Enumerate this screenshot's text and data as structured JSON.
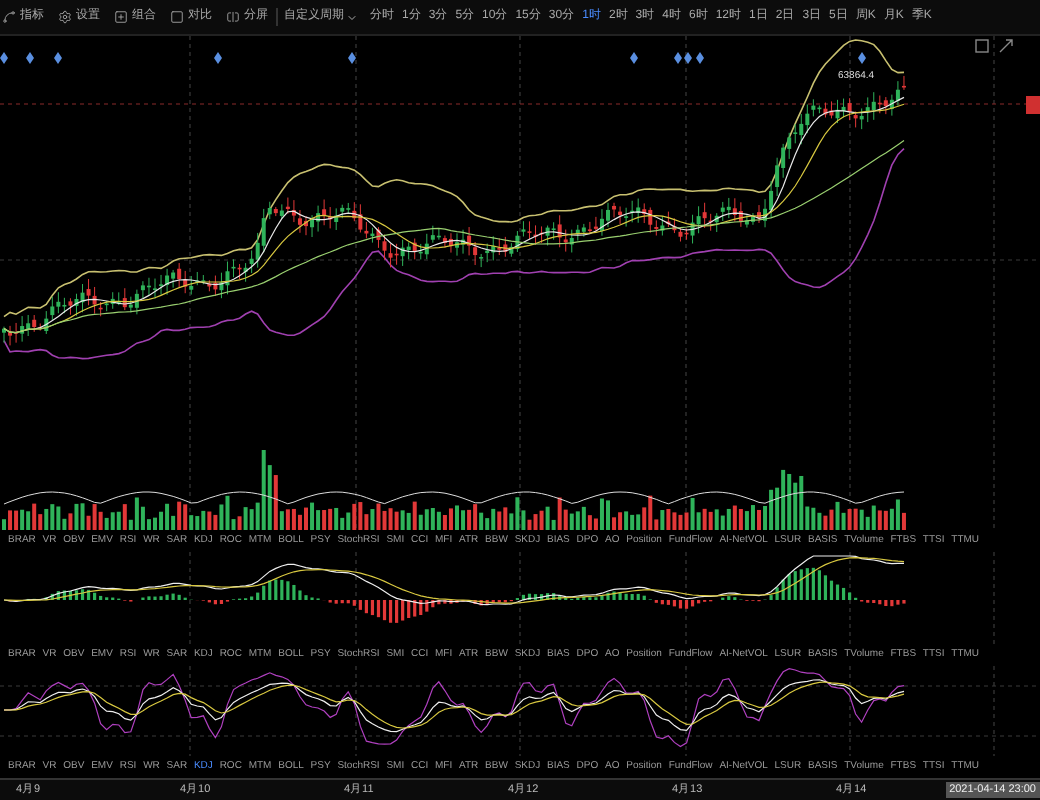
{
  "toolbar": {
    "tools": [
      {
        "kind": "draw",
        "label": "指标"
      },
      {
        "kind": "settings",
        "label": "设置"
      },
      {
        "kind": "combo",
        "label": "组合"
      },
      {
        "kind": "compare",
        "label": "对比"
      },
      {
        "kind": "split",
        "label": "分屏"
      }
    ],
    "custom_period": "自定义周期",
    "periods": [
      {
        "label": "分时",
        "selected": false
      },
      {
        "label": "1分",
        "selected": false
      },
      {
        "label": "3分",
        "selected": false
      },
      {
        "label": "5分",
        "selected": false
      },
      {
        "label": "10分",
        "selected": false
      },
      {
        "label": "15分",
        "selected": false
      },
      {
        "label": "30分",
        "selected": false
      },
      {
        "label": "1时",
        "selected": true
      },
      {
        "label": "2时",
        "selected": false
      },
      {
        "label": "3时",
        "selected": false
      },
      {
        "label": "4时",
        "selected": false
      },
      {
        "label": "6时",
        "selected": false
      },
      {
        "label": "12时",
        "selected": false
      },
      {
        "label": "1日",
        "selected": false
      },
      {
        "label": "2日",
        "selected": false
      },
      {
        "label": "3日",
        "selected": false
      },
      {
        "label": "5日",
        "selected": false
      },
      {
        "label": "周K",
        "selected": false
      },
      {
        "label": "月K",
        "selected": false
      },
      {
        "label": "季K",
        "selected": false
      }
    ]
  },
  "main_chart": {
    "price_label": "63864.4"
  },
  "indicator_rows": [
    {
      "tabs": [
        {
          "label": "BRAR",
          "selected": false
        },
        {
          "label": "VR",
          "selected": false
        },
        {
          "label": "OBV",
          "selected": false
        },
        {
          "label": "EMV",
          "selected": false
        },
        {
          "label": "RSI",
          "selected": false
        },
        {
          "label": "WR",
          "selected": false
        },
        {
          "label": "SAR",
          "selected": false
        },
        {
          "label": "KDJ",
          "selected": false
        },
        {
          "label": "ROC",
          "selected": false
        },
        {
          "label": "MTM",
          "selected": false
        },
        {
          "label": "BOLL",
          "selected": false
        },
        {
          "label": "PSY",
          "selected": false
        },
        {
          "label": "StochRSI",
          "selected": false
        },
        {
          "label": "SMI",
          "selected": false
        },
        {
          "label": "CCI",
          "selected": false
        },
        {
          "label": "MFI",
          "selected": false
        },
        {
          "label": "ATR",
          "selected": false
        },
        {
          "label": "BBW",
          "selected": false
        },
        {
          "label": "SKDJ",
          "selected": false
        },
        {
          "label": "BIAS",
          "selected": false
        },
        {
          "label": "DPO",
          "selected": false
        },
        {
          "label": "AO",
          "selected": false
        },
        {
          "label": "Position",
          "selected": false
        },
        {
          "label": "FundFlow",
          "selected": false
        },
        {
          "label": "AI-NetVOL",
          "selected": false
        },
        {
          "label": "LSUR",
          "selected": false
        },
        {
          "label": "BASIS",
          "selected": false
        },
        {
          "label": "TVolume",
          "selected": false
        },
        {
          "label": "FTBS",
          "selected": false
        },
        {
          "label": "TTSI",
          "selected": false
        },
        {
          "label": "TTMU",
          "selected": false
        }
      ]
    },
    {
      "tabs": [
        {
          "label": "BRAR",
          "selected": false
        },
        {
          "label": "VR",
          "selected": false
        },
        {
          "label": "OBV",
          "selected": false
        },
        {
          "label": "EMV",
          "selected": false
        },
        {
          "label": "RSI",
          "selected": false
        },
        {
          "label": "WR",
          "selected": false
        },
        {
          "label": "SAR",
          "selected": false
        },
        {
          "label": "KDJ",
          "selected": false
        },
        {
          "label": "ROC",
          "selected": false
        },
        {
          "label": "MTM",
          "selected": false
        },
        {
          "label": "BOLL",
          "selected": false
        },
        {
          "label": "PSY",
          "selected": false
        },
        {
          "label": "StochRSI",
          "selected": false
        },
        {
          "label": "SMI",
          "selected": false
        },
        {
          "label": "CCI",
          "selected": false
        },
        {
          "label": "MFI",
          "selected": false
        },
        {
          "label": "ATR",
          "selected": false
        },
        {
          "label": "BBW",
          "selected": false
        },
        {
          "label": "SKDJ",
          "selected": false
        },
        {
          "label": "BIAS",
          "selected": false
        },
        {
          "label": "DPO",
          "selected": false
        },
        {
          "label": "AO",
          "selected": false
        },
        {
          "label": "Position",
          "selected": false
        },
        {
          "label": "FundFlow",
          "selected": false
        },
        {
          "label": "AI-NetVOL",
          "selected": false
        },
        {
          "label": "LSUR",
          "selected": false
        },
        {
          "label": "BASIS",
          "selected": false
        },
        {
          "label": "TVolume",
          "selected": false
        },
        {
          "label": "FTBS",
          "selected": false
        },
        {
          "label": "TTSI",
          "selected": false
        },
        {
          "label": "TTMU",
          "selected": false
        }
      ]
    },
    {
      "tabs": [
        {
          "label": "BRAR",
          "selected": false
        },
        {
          "label": "VR",
          "selected": false
        },
        {
          "label": "OBV",
          "selected": false
        },
        {
          "label": "EMV",
          "selected": false
        },
        {
          "label": "RSI",
          "selected": false
        },
        {
          "label": "WR",
          "selected": false
        },
        {
          "label": "SAR",
          "selected": false
        },
        {
          "label": "KDJ",
          "selected": true
        },
        {
          "label": "ROC",
          "selected": false
        },
        {
          "label": "MTM",
          "selected": false
        },
        {
          "label": "BOLL",
          "selected": false
        },
        {
          "label": "PSY",
          "selected": false
        },
        {
          "label": "StochRSI",
          "selected": false
        },
        {
          "label": "SMI",
          "selected": false
        },
        {
          "label": "CCI",
          "selected": false
        },
        {
          "label": "MFI",
          "selected": false
        },
        {
          "label": "ATR",
          "selected": false
        },
        {
          "label": "BBW",
          "selected": false
        },
        {
          "label": "SKDJ",
          "selected": false
        },
        {
          "label": "BIAS",
          "selected": false
        },
        {
          "label": "DPO",
          "selected": false
        },
        {
          "label": "AO",
          "selected": false
        },
        {
          "label": "Position",
          "selected": false
        },
        {
          "label": "FundFlow",
          "selected": false
        },
        {
          "label": "AI-NetVOL",
          "selected": false
        },
        {
          "label": "LSUR",
          "selected": false
        },
        {
          "label": "BASIS",
          "selected": false
        },
        {
          "label": "TVolume",
          "selected": false
        },
        {
          "label": "FTBS",
          "selected": false
        },
        {
          "label": "TTSI",
          "selected": false
        },
        {
          "label": "TTMU",
          "selected": false
        }
      ]
    }
  ],
  "time_axis": {
    "dates": [
      "4月9",
      "4月10",
      "4月11",
      "4月12",
      "4月13",
      "4月14"
    ],
    "cursor_time": "2021-04-14 23:00"
  }
}
